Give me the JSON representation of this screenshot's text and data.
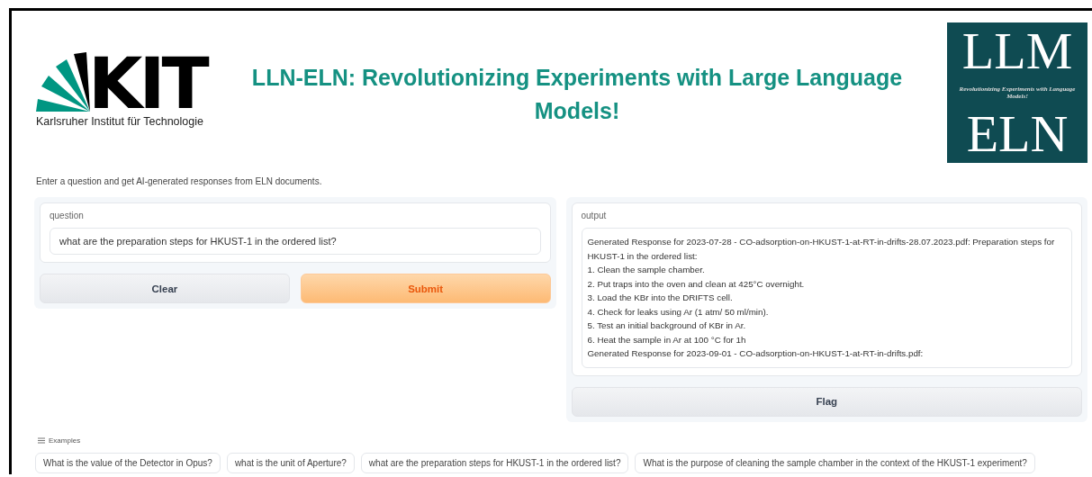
{
  "header": {
    "kit_logo": {
      "letters": "KIT",
      "caption": "Karlsruher Institut für Technologie"
    },
    "title": "LLN-ELN: Revolutionizing Experiments with Large Language Models!",
    "llm_logo": {
      "top": "LLM",
      "tagline": "Revolutionizing Experiments with Language Models!",
      "bottom": "ELN"
    }
  },
  "description": "Enter a question and get AI-generated responses from ELN documents.",
  "question": {
    "label": "question",
    "value": "what are the preparation steps for HKUST-1 in the ordered list?"
  },
  "buttons": [
    {
      "label": "Clear",
      "kind": "secondary"
    },
    {
      "label": "Submit",
      "kind": "primary"
    }
  ],
  "output": {
    "label": "output",
    "lines": [
      "Generated Response for 2023-07-28 - CO-adsorption-on-HKUST-1-at-RT-in-drifts-28.07.2023.pdf: Preparation steps for HKUST-1 in the ordered list:",
      "1. Clean the sample chamber.",
      "2. Put traps into the oven and clean at 425°C overnight.",
      "3. Load the KBr into the DRIFTS cell.",
      "4. Check for leaks using Ar (1 atm/ 50 ml/min).",
      "5. Test an initial background of KBr in Ar.",
      "6. Heat the sample in Ar at 100 °C for 1h",
      "Generated Response for 2023-09-01 - CO-adsorption-on-HKUST-1-at-RT-in-drifts.pdf:"
    ]
  },
  "flag_button": "Flag",
  "examples": {
    "label": "Examples",
    "items": [
      "What is the value of the Detector in Opus?",
      "what is the unit of Aperture?",
      "what are the preparation steps for HKUST-1 in the ordered list?",
      "What is the purpose of cleaning the sample chamber in the context of the HKUST-1 experiment?"
    ]
  }
}
